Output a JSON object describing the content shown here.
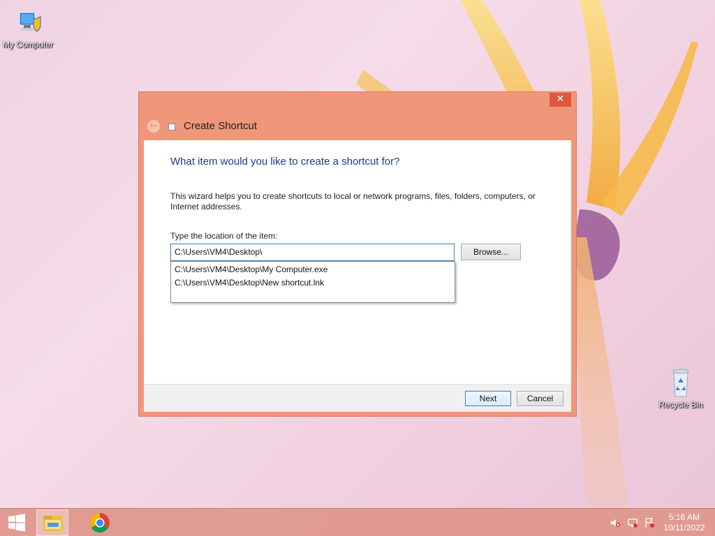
{
  "desktop": {
    "icons": [
      {
        "label": "My Computer",
        "icon": "computer-icon"
      },
      {
        "label": "Recycle Bin",
        "icon": "recycle-bin-icon"
      }
    ]
  },
  "wizard": {
    "title": "Create Shortcut",
    "close_label": "✕",
    "back_label": "←",
    "heading": "What item would you like to create a shortcut for?",
    "description": "This wizard helps you to create shortcuts to local or network programs, files, folders, computers, or Internet addresses.",
    "location_label": "Type the location of the item:",
    "location_value": "C:\\Users\\VM4\\Desktop\\",
    "browse_label": "Browse...",
    "autocomplete": [
      "C:\\Users\\VM4\\Desktop\\My Computer.exe",
      "C:\\Users\\VM4\\Desktop\\New shortcut.lnk"
    ],
    "next_label": "Next",
    "cancel_label": "Cancel"
  },
  "taskbar": {
    "apps": [
      "file-explorer-icon",
      "chrome-icon"
    ],
    "tray": [
      "volume-muted-icon",
      "network-icon",
      "action-center-flag-icon"
    ],
    "time": "5:16 AM",
    "date": "10/11/2022"
  },
  "colors": {
    "window_frame": "#f0977a",
    "close_button": "#e0573f",
    "heading_text": "#1a3a8a",
    "taskbar": "#de968c"
  }
}
